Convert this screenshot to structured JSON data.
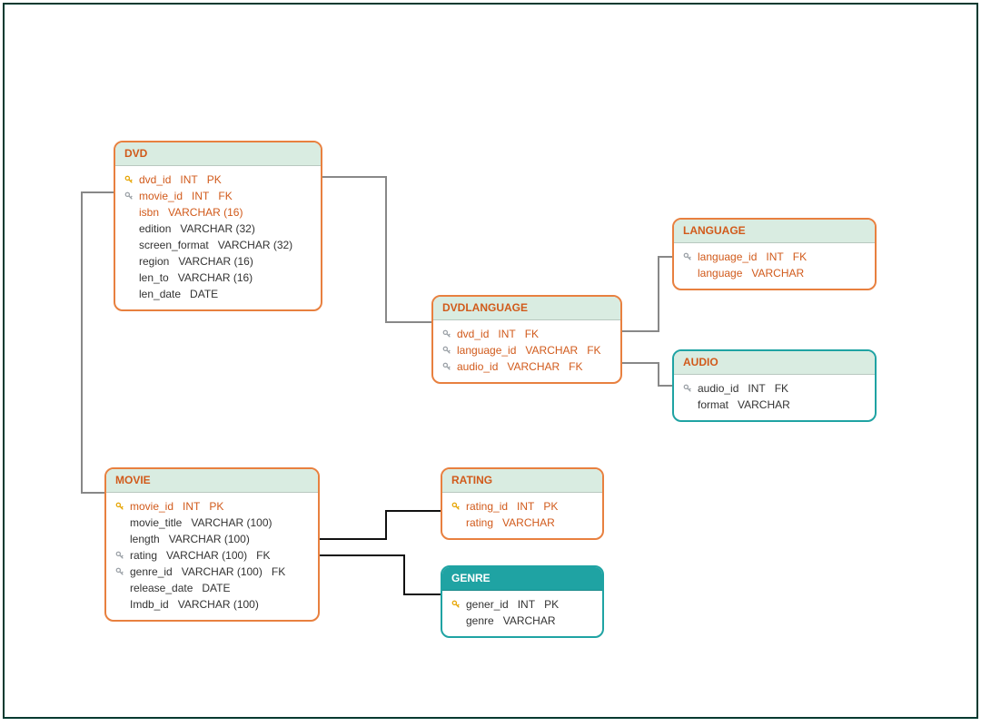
{
  "entities": {
    "dvd": {
      "title": "DVD",
      "rows": [
        {
          "icon": "pk",
          "name": "dvd_id",
          "type": "INT",
          "flag": "PK",
          "hl": true
        },
        {
          "icon": "fk",
          "name": "movie_id",
          "type": "INT",
          "flag": "FK",
          "hl": true
        },
        {
          "icon": "",
          "name": "isbn",
          "type": "VARCHAR (16)",
          "flag": "",
          "hl": true
        },
        {
          "icon": "",
          "name": "edition",
          "type": "VARCHAR (32)",
          "flag": "",
          "hl": false
        },
        {
          "icon": "",
          "name": "screen_format",
          "type": "VARCHAR (32)",
          "flag": "",
          "hl": false
        },
        {
          "icon": "",
          "name": "region",
          "type": "VARCHAR (16)",
          "flag": "",
          "hl": false
        },
        {
          "icon": "",
          "name": "len_to",
          "type": "VARCHAR (16)",
          "flag": "",
          "hl": false
        },
        {
          "icon": "",
          "name": "len_date",
          "type": "DATE",
          "flag": "",
          "hl": false
        }
      ]
    },
    "dvdlanguage": {
      "title": "DVDLANGUAGE",
      "rows": [
        {
          "icon": "fk",
          "name": "dvd_id",
          "type": "INT",
          "flag": "FK",
          "hl": true
        },
        {
          "icon": "fk",
          "name": "language_id",
          "type": "VARCHAR",
          "flag": "FK",
          "hl": true
        },
        {
          "icon": "fk",
          "name": "audio_id",
          "type": "VARCHAR",
          "flag": "FK",
          "hl": true
        }
      ]
    },
    "language": {
      "title": "LANGUAGE",
      "rows": [
        {
          "icon": "fk",
          "name": "language_id",
          "type": "INT",
          "flag": "FK",
          "hl": true
        },
        {
          "icon": "",
          "name": "language",
          "type": "VARCHAR",
          "flag": "",
          "hl": true
        }
      ]
    },
    "audio": {
      "title": "AUDIO",
      "rows": [
        {
          "icon": "fk",
          "name": "audio_id",
          "type": "INT",
          "flag": "FK",
          "hl": false
        },
        {
          "icon": "",
          "name": "format",
          "type": "VARCHAR",
          "flag": "",
          "hl": false
        }
      ]
    },
    "movie": {
      "title": "MOVIE",
      "rows": [
        {
          "icon": "pk",
          "name": "movie_id",
          "type": "INT",
          "flag": "PK",
          "hl": true
        },
        {
          "icon": "",
          "name": "movie_title",
          "type": "VARCHAR (100)",
          "flag": "",
          "hl": false
        },
        {
          "icon": "",
          "name": "length",
          "type": "VARCHAR (100)",
          "flag": "",
          "hl": false
        },
        {
          "icon": "fk",
          "name": "rating",
          "type": "VARCHAR (100)",
          "flag": "FK",
          "hl": false
        },
        {
          "icon": "fk",
          "name": "genre_id",
          "type": "VARCHAR (100)",
          "flag": "FK",
          "hl": false
        },
        {
          "icon": "",
          "name": "release_date",
          "type": "DATE",
          "flag": "",
          "hl": false
        },
        {
          "icon": "",
          "name": "Imdb_id",
          "type": "VARCHAR (100)",
          "flag": "",
          "hl": false
        }
      ]
    },
    "rating": {
      "title": "RATING",
      "rows": [
        {
          "icon": "pk",
          "name": "rating_id",
          "type": "INT",
          "flag": "PK",
          "hl": true
        },
        {
          "icon": "",
          "name": "rating",
          "type": "VARCHAR",
          "flag": "",
          "hl": true
        }
      ]
    },
    "genre": {
      "title": "GENRE",
      "rows": [
        {
          "icon": "pk",
          "name": "gener_id",
          "type": "INT",
          "flag": "PK",
          "hl": false
        },
        {
          "icon": "",
          "name": "genre",
          "type": "VARCHAR",
          "flag": "",
          "hl": false
        }
      ]
    }
  }
}
